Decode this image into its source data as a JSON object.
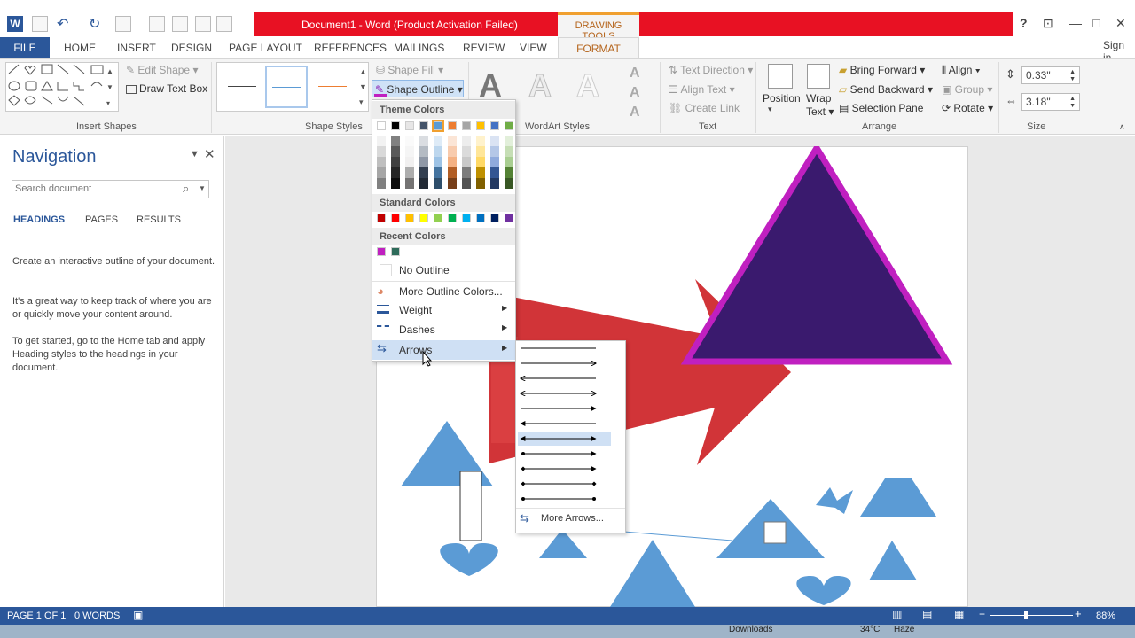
{
  "window": {
    "title": "Document1 - Word (Product Activation Failed)",
    "drawing_tools": "DRAWING TOOLS",
    "help": "?",
    "sign_in": "Sign in"
  },
  "tabs": [
    "FILE",
    "HOME",
    "INSERT",
    "DESIGN",
    "PAGE LAYOUT",
    "REFERENCES",
    "MAILINGS",
    "REVIEW",
    "VIEW",
    "FORMAT"
  ],
  "ribbon": {
    "insert_shapes": {
      "label": "Insert Shapes",
      "edit_shape": "Edit Shape",
      "draw_text_box": "Draw Text Box"
    },
    "shape_styles": {
      "label": "Shape Styles",
      "shape_fill": "Shape Fill",
      "shape_outline": "Shape Outline"
    },
    "wordart": {
      "label": "WordArt Styles",
      "sample": "A"
    },
    "text": {
      "label": "Text",
      "text_direction": "Text Direction",
      "align_text": "Align Text",
      "create_link": "Create Link"
    },
    "arrange": {
      "label": "Arrange",
      "position": "Position",
      "wrap_text_1": "Wrap",
      "wrap_text_2": "Text",
      "bring_forward": "Bring Forward",
      "send_backward": "Send Backward",
      "selection_pane": "Selection Pane",
      "align": "Align",
      "group": "Group",
      "rotate": "Rotate"
    },
    "size": {
      "label": "Size",
      "height": "0.33\"",
      "width": "3.18\""
    }
  },
  "outline_menu": {
    "theme_colors": "Theme Colors",
    "standard_colors": "Standard Colors",
    "recent_colors": "Recent Colors",
    "no_outline": "No Outline",
    "more_colors": "More Outline Colors...",
    "weight": "Weight",
    "dashes": "Dashes",
    "arrows": "Arrows",
    "theme_top": [
      "#ffffff",
      "#000000",
      "#e7e6e6",
      "#44546a",
      "#5b9bd5",
      "#ed7d31",
      "#a5a5a5",
      "#ffc000",
      "#4472c4",
      "#70ad47"
    ],
    "standard": [
      "#c00000",
      "#ff0000",
      "#ffc000",
      "#ffff00",
      "#92d050",
      "#00b050",
      "#00b0f0",
      "#0070c0",
      "#002060",
      "#7030a0"
    ],
    "recent": [
      "#c020c0",
      "#2e6b5a"
    ]
  },
  "arrows_menu": {
    "more": "More Arrows..."
  },
  "navigation": {
    "title": "Navigation",
    "search_placeholder": "Search document",
    "tabs": [
      "HEADINGS",
      "PAGES",
      "RESULTS"
    ],
    "p1": "Create an interactive outline of your document.",
    "p2": "It's a great way to keep track of where you are or quickly move your content around.",
    "p3": "To get started, go to the Home tab and apply Heading styles to the headings in your document."
  },
  "status": {
    "page": "PAGE 1 OF 1",
    "words": "0 WORDS",
    "zoom": "88%"
  },
  "taskbar": {
    "downloads": "Downloads",
    "temp": "34°C",
    "weather": "Haze"
  }
}
